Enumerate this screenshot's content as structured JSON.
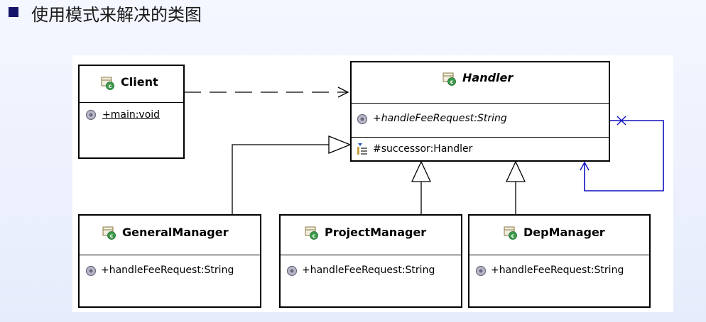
{
  "slide": {
    "title": "使用模式来解决的类图"
  },
  "classes": {
    "client": {
      "name": "Client",
      "method": "+main:void",
      "icon": "class-icon"
    },
    "handler": {
      "name": "Handler",
      "method": "+handleFeeRequest:String",
      "field": "#successor:Handler",
      "icon": "abstract-class-icon"
    },
    "general_manager": {
      "name": "GeneralManager",
      "method": "+handleFeeRequest:String",
      "icon": "class-icon"
    },
    "project_manager": {
      "name": "ProjectManager",
      "method": "+handleFeeRequest:String",
      "icon": "class-icon"
    },
    "dep_manager": {
      "name": "DepManager",
      "method": "+handleFeeRequest:String",
      "icon": "class-icon"
    }
  },
  "relations": [
    {
      "type": "dependency",
      "from": "Client",
      "to": "Handler"
    },
    {
      "type": "generalization",
      "from": "GeneralManager",
      "to": "Handler"
    },
    {
      "type": "generalization",
      "from": "ProjectManager",
      "to": "Handler"
    },
    {
      "type": "generalization",
      "from": "DepManager",
      "to": "Handler"
    },
    {
      "type": "self-association",
      "from": "Handler",
      "to": "Handler"
    }
  ],
  "colors": {
    "bullet": "#141468",
    "self_association": "#1010c0",
    "class_icon_accent": "#2e8b3a",
    "method_icon": "#7a7a96"
  }
}
